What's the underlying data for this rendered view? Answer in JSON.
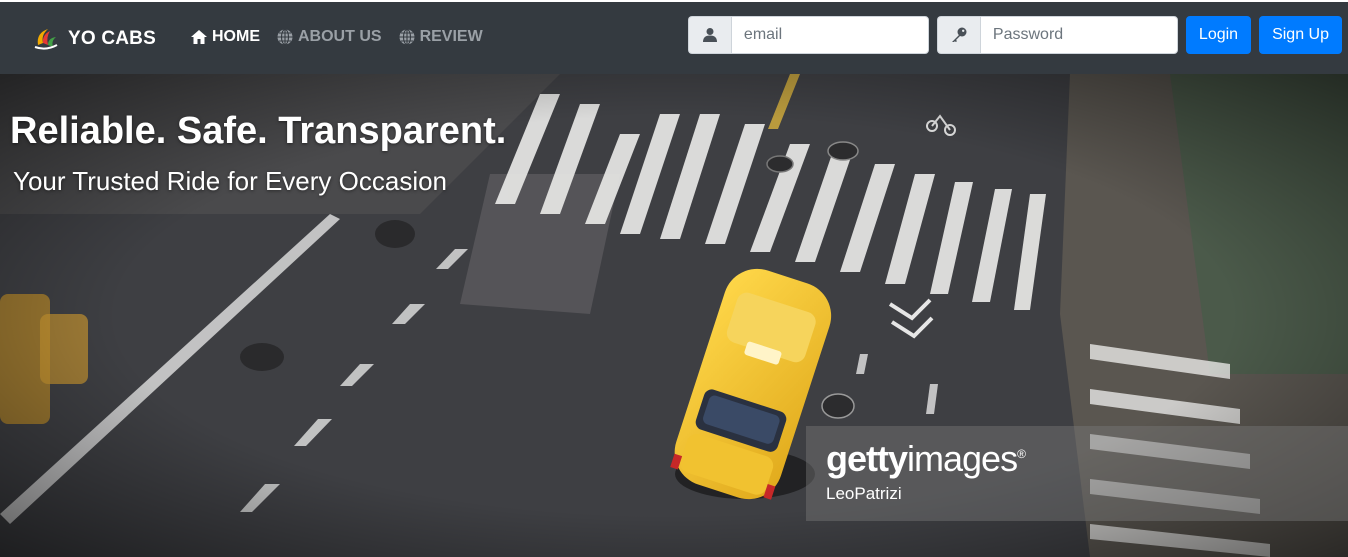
{
  "navbar": {
    "brand": "YO CABS",
    "links": [
      {
        "label": "HOME",
        "icon": "home-icon",
        "active": true
      },
      {
        "label": "ABOUT US",
        "icon": "globe-icon",
        "active": false
      },
      {
        "label": "REVIEW",
        "icon": "globe-icon",
        "active": false
      }
    ],
    "email_placeholder": "email",
    "password_placeholder": "Password",
    "login_label": "Login",
    "signup_label": "Sign Up"
  },
  "hero": {
    "title": "Reliable. Safe. Transparent.",
    "subtitle": "Your Trusted Ride for Every Occasion",
    "watermark_brand_bold": "getty",
    "watermark_brand_light": "images",
    "watermark_mark": "®",
    "watermark_credit": "LeoPatrizi"
  },
  "colors": {
    "navbar_bg": "#343a40",
    "primary": "#007bff",
    "taxi": "#f2c230"
  }
}
